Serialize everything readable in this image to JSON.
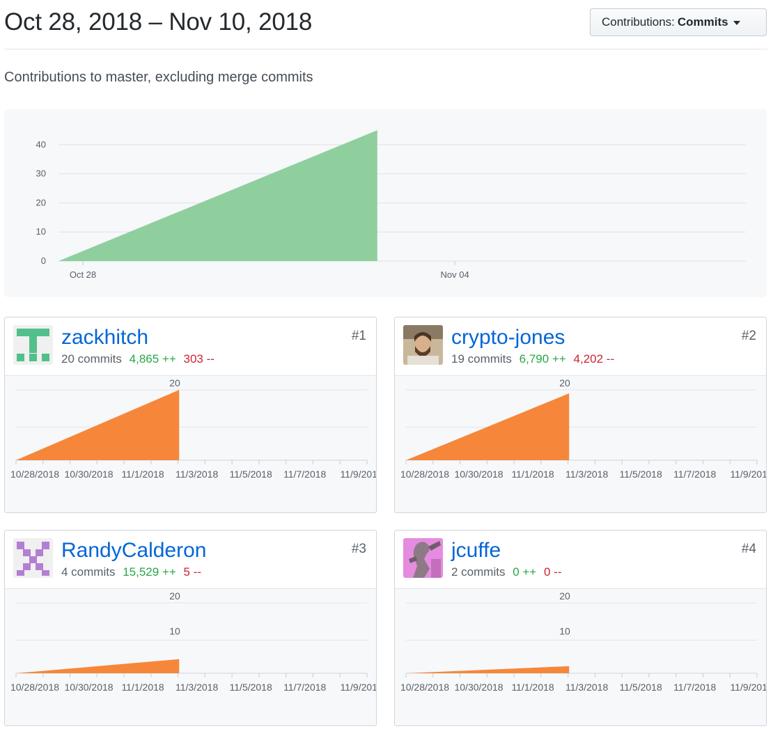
{
  "header": {
    "range_title": "Oct 28, 2018 – Nov 10, 2018",
    "dropdown_prefix": "Contributions:",
    "dropdown_value": "Commits"
  },
  "subtitle": "Contributions to master, excluding merge commits",
  "colors": {
    "main_area": "#8fcf9e",
    "user_area": "#f6873a",
    "link": "#0366d6",
    "additions": "#28a745",
    "deletions": "#cb2431"
  },
  "chart_data": [
    {
      "type": "area",
      "title": "",
      "x": [
        "2018-10-28",
        "2018-11-03"
      ],
      "series": [
        {
          "values": [
            0,
            45
          ]
        }
      ],
      "xticks": [
        "Oct 28",
        "Nov 04"
      ],
      "yticks": [
        "0",
        "10",
        "20",
        "30",
        "40"
      ],
      "ylim": [
        0,
        45
      ],
      "grid": true
    },
    {
      "type": "area",
      "x": [
        "10/28/2018",
        "11/3/2018"
      ],
      "series": [
        {
          "values": [
            0,
            20
          ]
        }
      ],
      "ylim": [
        0,
        20
      ],
      "yticks": [
        "20"
      ],
      "xticks": [
        "10/28/2018",
        "10/30/2018",
        "11/1/2018",
        "11/3/2018",
        "11/5/2018",
        "11/7/2018",
        "11/9/201"
      ]
    },
    {
      "type": "area",
      "x": [
        "10/28/2018",
        "11/3/2018"
      ],
      "series": [
        {
          "values": [
            0,
            19
          ]
        }
      ],
      "ylim": [
        0,
        20
      ],
      "yticks": [
        "20"
      ],
      "xticks": [
        "10/28/2018",
        "10/30/2018",
        "11/1/2018",
        "11/3/2018",
        "11/5/2018",
        "11/7/2018",
        "11/9/201"
      ]
    },
    {
      "type": "area",
      "x": [
        "10/28/2018",
        "11/3/2018"
      ],
      "series": [
        {
          "values": [
            0,
            4
          ]
        }
      ],
      "ylim": [
        0,
        20
      ],
      "yticks": [
        "20",
        "10"
      ],
      "xticks": [
        "10/28/2018",
        "10/30/2018",
        "11/1/2018",
        "11/3/2018",
        "11/5/2018",
        "11/7/2018",
        "11/9/201"
      ]
    },
    {
      "type": "area",
      "x": [
        "10/28/2018",
        "11/3/2018"
      ],
      "series": [
        {
          "values": [
            0,
            2
          ]
        }
      ],
      "ylim": [
        0,
        20
      ],
      "yticks": [
        "20",
        "10"
      ],
      "xticks": [
        "10/28/2018",
        "10/30/2018",
        "11/1/2018",
        "11/3/2018",
        "11/5/2018",
        "11/7/2018",
        "11/9/201"
      ]
    }
  ],
  "contributors": [
    {
      "name": "zackhitch",
      "commits": "20 commits",
      "additions": "4,865 ++",
      "deletions": "303 --",
      "rank": "#1",
      "avatar": "identicon-green"
    },
    {
      "name": "crypto-jones",
      "commits": "19 commits",
      "additions": "6,790 ++",
      "deletions": "4,202 --",
      "rank": "#2",
      "avatar": "photo-bearded-man"
    },
    {
      "name": "RandyCalderon",
      "commits": "4 commits",
      "additions": "15,529 ++",
      "deletions": "5 --",
      "rank": "#3",
      "avatar": "identicon-purple"
    },
    {
      "name": "jcuffe",
      "commits": "2 commits",
      "additions": "0 ++",
      "deletions": "0 --",
      "rank": "#4",
      "avatar": "photo-pink-statue"
    }
  ]
}
